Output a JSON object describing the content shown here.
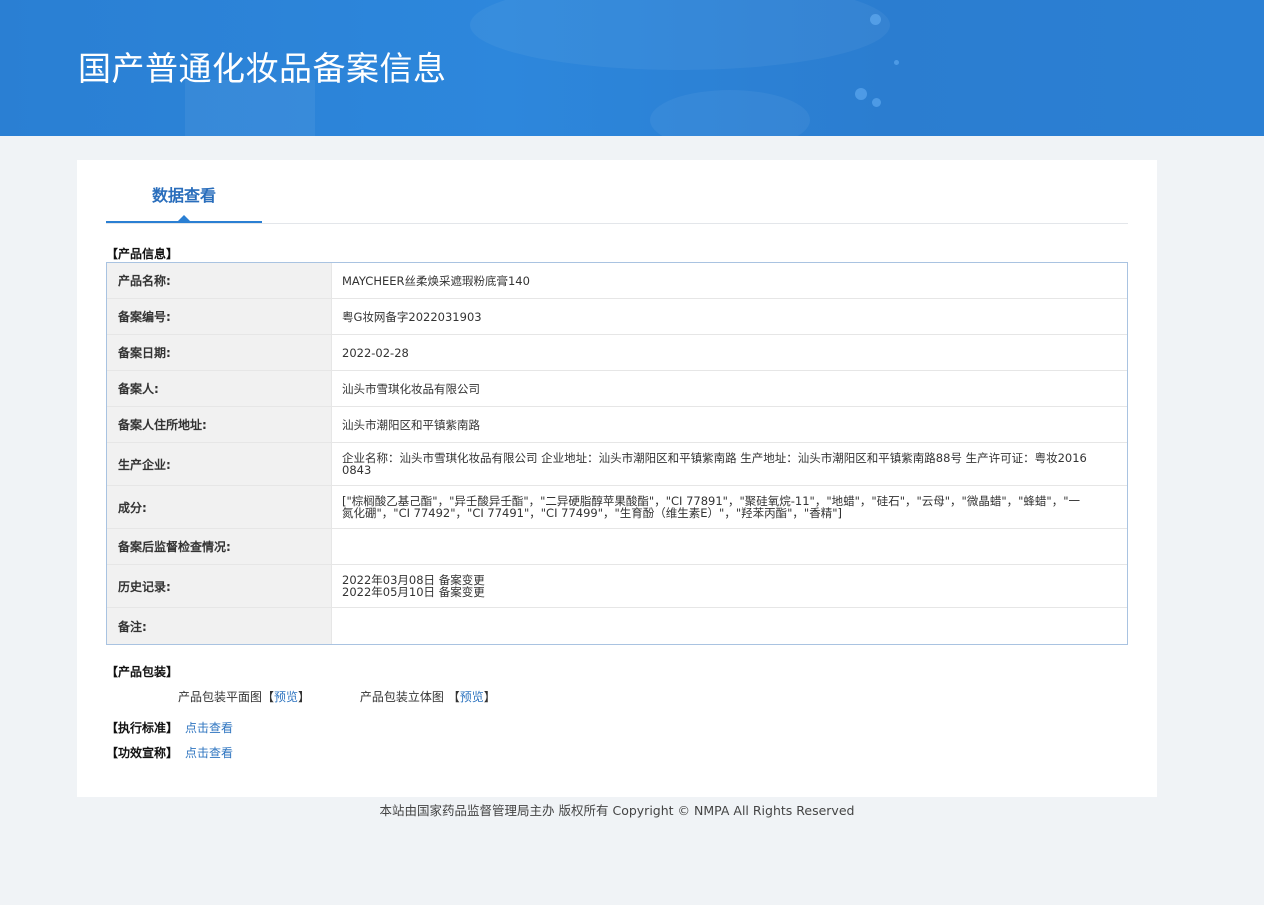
{
  "header": {
    "title": "国产普通化妆品备案信息"
  },
  "tabs": [
    {
      "label": "数据查看"
    }
  ],
  "product_info": {
    "section_title": "【产品信息】",
    "rows": [
      {
        "label": "产品名称:",
        "value": "MAYCHEER丝柔焕采遮瑕粉底膏140"
      },
      {
        "label": "备案编号:",
        "value": "粤G妆网备字2022031903"
      },
      {
        "label": "备案日期:",
        "value": "2022-02-28"
      },
      {
        "label": "备案人:",
        "value": "汕头市雪琪化妆品有限公司"
      },
      {
        "label": "备案人住所地址:",
        "value": "汕头市潮阳区和平镇紫南路"
      },
      {
        "label": "生产企业:",
        "value": "企业名称：汕头市雪琪化妆品有限公司 企业地址：汕头市潮阳区和平镇紫南路 生产地址：汕头市潮阳区和平镇紫南路88号 生产许可证：粤妆20160843"
      },
      {
        "label": "成分:",
        "value": "[\"棕榈酸乙基己酯\"，\"异壬酸异壬酯\"，\"二异硬脂醇苹果酸酯\"，\"CI 77891\"，\"聚硅氧烷-11\"，\"地蜡\"，\"硅石\"，\"云母\"，\"微晶蜡\"，\"蜂蜡\"，\"一氮化硼\"，\"CI 77492\"，\"CI 77491\"，\"CI 77499\"，\"生育酚（维生素E）\"，\"羟苯丙酯\"，\"香精\"]"
      },
      {
        "label": "备案后监督检查情况:",
        "value": ""
      },
      {
        "label": "历史记录:",
        "value": "2022年03月08日 备案变更\n2022年05月10日 备案变更"
      },
      {
        "label": "备注:",
        "value": ""
      }
    ]
  },
  "packaging": {
    "section_title": "【产品包装】",
    "flat_label": "产品包装平面图",
    "flat_link": "预览",
    "solid_label": "产品包装立体图",
    "solid_link": "预览"
  },
  "standard": {
    "label": "【执行标准】",
    "link": "点击查看"
  },
  "efficacy": {
    "label": "【功效宣称】",
    "link": "点击查看"
  },
  "footer": {
    "text": "本站由国家药品监督管理局主办 版权所有 Copyright © NMPA All Rights Reserved"
  },
  "colors": {
    "banner": "#2a7fd3",
    "accent_text": "#2a6ebc",
    "link": "#2f75c0",
    "table_border": "#a9c3e1",
    "label_bg": "#f1f1f1",
    "page_bg": "#f0f3f6"
  }
}
